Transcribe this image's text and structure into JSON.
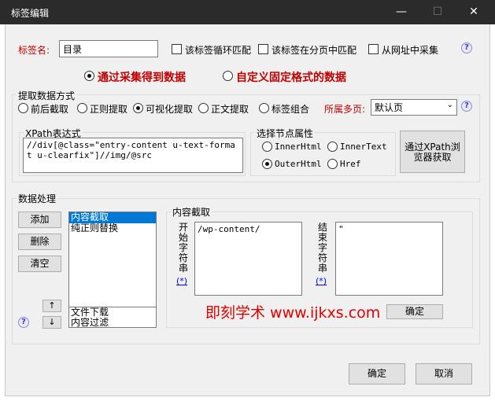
{
  "window": {
    "title": "标签编辑",
    "minimize": "—",
    "maximize": "☐",
    "close": "✕"
  },
  "tag": {
    "name_label": "标签名:",
    "name_value": "目录",
    "loop_match": "该标签循环匹配",
    "page_match": "该标签在分页中匹配",
    "from_url": "从网址中采集"
  },
  "source_mode": {
    "collect": "通过采集得到数据",
    "custom": "自定义固定格式的数据"
  },
  "extract": {
    "title": "提取数据方式",
    "options": [
      "前后截取",
      "正则提取",
      "可视化提取",
      "正文提取",
      "标签组合"
    ],
    "selected": "可视化提取",
    "page_label": "所属多页:",
    "page_value": "默认页",
    "xpath_title": "XPath表达式",
    "xpath_value": "//div[@class=\"entry-content u-text-format u-clearfix\"]//img/@src",
    "node_title": "选择节点属性",
    "node_options": [
      "InnerHtml",
      "InnerText",
      "OuterHtml",
      "Href"
    ],
    "node_selected": "OuterHtml",
    "browser_button": "通过XPath浏览器获取"
  },
  "processing": {
    "title": "数据处理",
    "add": "添加",
    "delete": "删除",
    "clear": "清空",
    "up": "↑",
    "down": "↓",
    "list_top": [
      "内容截取",
      "纯正则替换"
    ],
    "list_bottom": [
      "文件下载",
      "内容过滤"
    ],
    "crop_title": "内容截取",
    "start_label": "开始字符串",
    "start_value": "/wp-content/",
    "start_link": "(*)",
    "end_label": "结束字符串",
    "end_value": "\"",
    "end_link": "(*)",
    "confirm_inner": "确定"
  },
  "watermark": "即刻学术 www.ijkxs.com",
  "footer": {
    "ok": "确定",
    "cancel": "取消"
  },
  "colors": {
    "titlebar": "#2b2b2b",
    "accent_red": "#c00000",
    "selection": "#0078d7"
  }
}
